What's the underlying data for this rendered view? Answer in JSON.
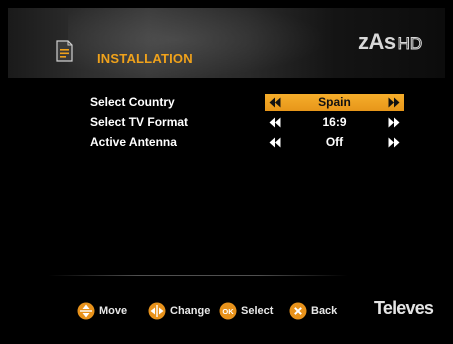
{
  "header": {
    "title": "INSTALLATION",
    "brand": "zAs",
    "brand_suffix": "HD",
    "title_icon": "document-icon"
  },
  "menu": {
    "items": [
      {
        "label": "Select Country",
        "value": "Spain",
        "selected": true
      },
      {
        "label": "Select TV Format",
        "value": "16:9",
        "selected": false
      },
      {
        "label": "Active Antenna",
        "value": "Off",
        "selected": false
      }
    ]
  },
  "footer": {
    "hints": [
      {
        "icon": "move-icon",
        "label": "Move"
      },
      {
        "icon": "change-icon",
        "label": "Change"
      },
      {
        "icon": "ok-icon",
        "label": "Select",
        "icon_text": "OK"
      },
      {
        "icon": "back-icon",
        "label": "Back"
      }
    ],
    "logo": "Televes"
  },
  "colors": {
    "accent": "#f0a21b",
    "highlight": "#f2a627",
    "background": "#000000"
  }
}
